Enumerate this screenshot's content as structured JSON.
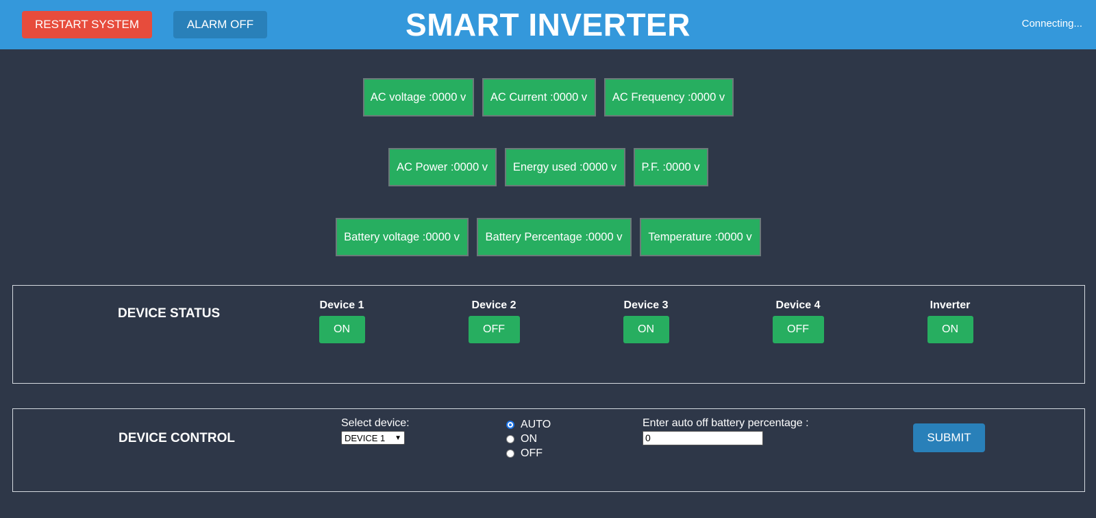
{
  "header": {
    "restart_label": "RESTART SYSTEM",
    "alarm_label": "ALARM OFF",
    "title": "SMART INVERTER",
    "status": "Connecting..."
  },
  "metrics": {
    "row1": [
      "AC voltage :0000 v",
      "AC Current :0000 v",
      "AC Frequency :0000 v"
    ],
    "row2": [
      "AC Power :0000 v",
      "Energy used :0000 v",
      "P.F. :0000 v"
    ],
    "row3": [
      "Battery voltage :0000 v",
      "Battery Percentage :0000 v",
      "Temperature :0000 v"
    ]
  },
  "device_status": {
    "title": "DEVICE STATUS",
    "devices": [
      {
        "label": "Device 1",
        "state": "ON"
      },
      {
        "label": "Device 2",
        "state": "OFF"
      },
      {
        "label": "Device 3",
        "state": "ON"
      },
      {
        "label": "Device 4",
        "state": "OFF"
      },
      {
        "label": "Inverter",
        "state": "ON"
      }
    ]
  },
  "device_control": {
    "title": "DEVICE CONTROL",
    "select_label": "Select device:",
    "select_value": "DEVICE 1",
    "modes": [
      "AUTO",
      "ON",
      "OFF"
    ],
    "selected_mode": "AUTO",
    "percentage_label": "Enter auto off battery percentage :",
    "percentage_value": "0",
    "submit_label": "SUBMIT"
  },
  "colors": {
    "header_bg": "#3498db",
    "page_bg": "#2e3748",
    "restart_bg": "#e74c3c",
    "alarm_bg": "#2980b9",
    "status_green": "#27ae60"
  }
}
